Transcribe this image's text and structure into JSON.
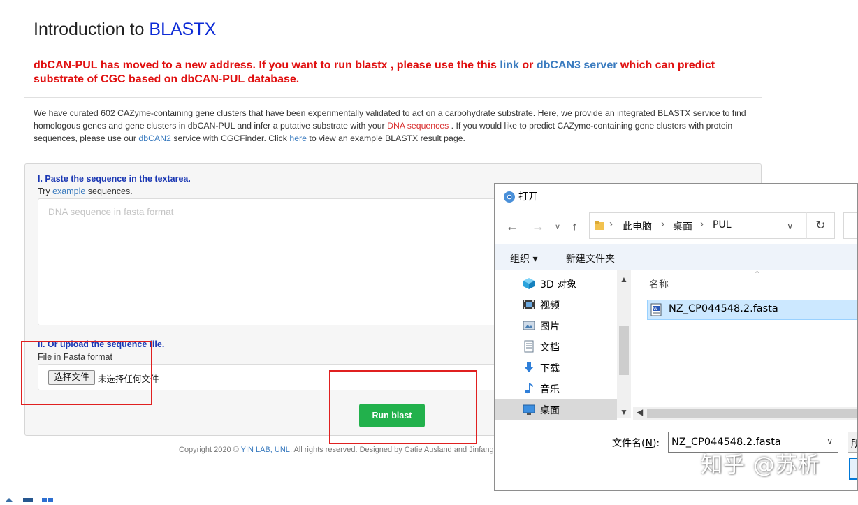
{
  "page": {
    "title_prefix": "Introduction to ",
    "title_accent": "BLASTX",
    "notice": {
      "part1": "dbCAN-PUL has moved to a new address. If you want to run blastx , please use the this ",
      "link1": "link",
      "part2": " or ",
      "link2": "dbCAN3 server",
      "part3": " which can predict substrate of CGC based on dbCAN-PUL database."
    },
    "intro": {
      "p1": "We have curated 602 CAZyme-containing gene clusters that have been experimentally validated to act on a carbohydrate substrate. Here, we provide an integrated BLASTX service to find homologous genes and gene clusters in dbCAN-PUL and infer a putative substrate with your ",
      "dna_link": "DNA sequences",
      "p2": " . If you would like to predict CAZyme-containing gene clusters with protein sequences, please use our ",
      "dbcan2_link": "dbCAN2",
      "p3": " service with CGCFinder. Click ",
      "here_link": "here",
      "p4": " to view an example BLASTX result page."
    },
    "section1": {
      "title": "I. Paste the sequence in the textarea.",
      "hint_prefix": "Try ",
      "hint_link": "example",
      "hint_suffix": " sequences.",
      "textarea_placeholder": "DNA sequence in fasta format",
      "textarea_value": ""
    },
    "section2": {
      "title": "II. Or upload the sequence file.",
      "subtitle": "File in Fasta format",
      "choose_button": "选择文件",
      "no_file_text": "未选择任何文件"
    },
    "run_button": "Run blast",
    "footer": {
      "prefix": "Copyright 2020 © ",
      "lab_link": "YIN LAB, UNL",
      "suffix": ". All rights reserved. Designed by Catie Ausland and Jinfang"
    }
  },
  "dialog": {
    "title": "打开",
    "breadcrumb": [
      "此电脑",
      "桌面",
      "PUL"
    ],
    "toolbar": {
      "organize": "组织 ▾",
      "new_folder": "新建文件夹"
    },
    "nav_items": [
      {
        "label": "3D 对象",
        "icon": "cube-3d-icon"
      },
      {
        "label": "视频",
        "icon": "video-icon"
      },
      {
        "label": "图片",
        "icon": "picture-icon"
      },
      {
        "label": "文档",
        "icon": "document-icon"
      },
      {
        "label": "下载",
        "icon": "download-icon"
      },
      {
        "label": "音乐",
        "icon": "music-icon"
      },
      {
        "label": "桌面",
        "icon": "desktop-icon",
        "selected": true
      }
    ],
    "column_header": "名称",
    "files": [
      {
        "name": "NZ_CP044548.2.fasta",
        "selected": true
      }
    ],
    "filename_label": "文件名(",
    "filename_label_key": "N",
    "filename_label_end": "):",
    "filename_value": "NZ_CP044548.2.fasta",
    "filetype_partial": "所"
  },
  "watermark": "知乎 @苏析",
  "colors": {
    "title_accent": "#0d2bd6",
    "notice_red": "#e01010",
    "link_blue": "#3a7bbf",
    "run_green": "#22b14c",
    "annotation_red": "#e02020",
    "selection_blue": "#cce8ff"
  }
}
